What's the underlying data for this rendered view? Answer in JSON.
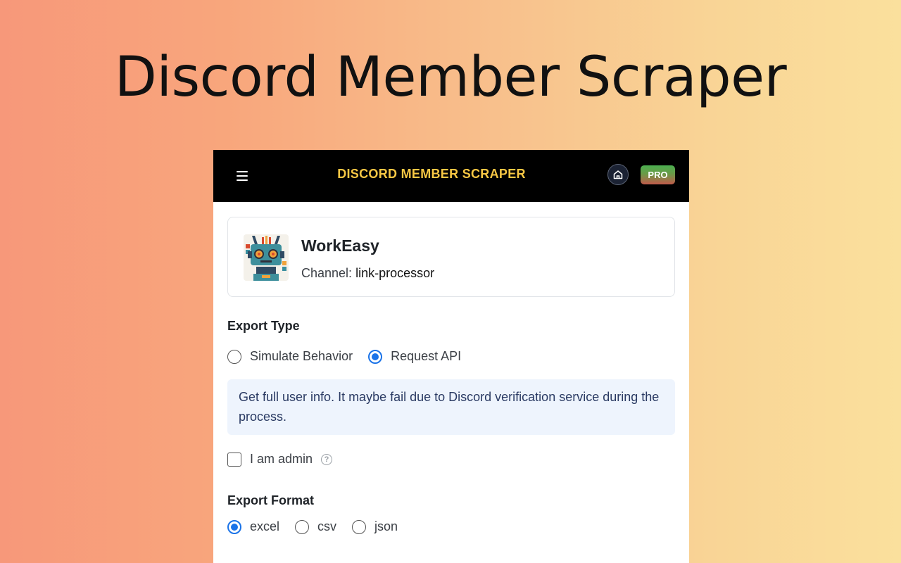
{
  "hero": {
    "title": "Discord Member Scraper"
  },
  "topbar": {
    "title": "DISCORD MEMBER SCRAPER",
    "pro_label": "PRO",
    "menu_icon": "hamburger-menu-icon",
    "home_icon": "home-icon"
  },
  "server": {
    "name": "WorkEasy",
    "channel_prefix": "Channel:",
    "channel_name": "link-processor",
    "avatar_icon": "robot-avatar"
  },
  "export_type": {
    "label": "Export Type",
    "options": [
      {
        "label": "Simulate Behavior",
        "checked": false
      },
      {
        "label": "Request API",
        "checked": true
      }
    ],
    "info": "Get full user info. It maybe fail due to Discord verification service during the process."
  },
  "admin": {
    "label": "I am admin",
    "checked": false,
    "help_icon": "question-circle-icon"
  },
  "export_format": {
    "label": "Export Format",
    "options": [
      {
        "label": "excel",
        "checked": true
      },
      {
        "label": "csv",
        "checked": false
      },
      {
        "label": "json",
        "checked": false
      }
    ]
  },
  "colors": {
    "accent": "#1a73e8",
    "title_gold": "#F7C744",
    "info_bg": "#EEF4FD"
  }
}
